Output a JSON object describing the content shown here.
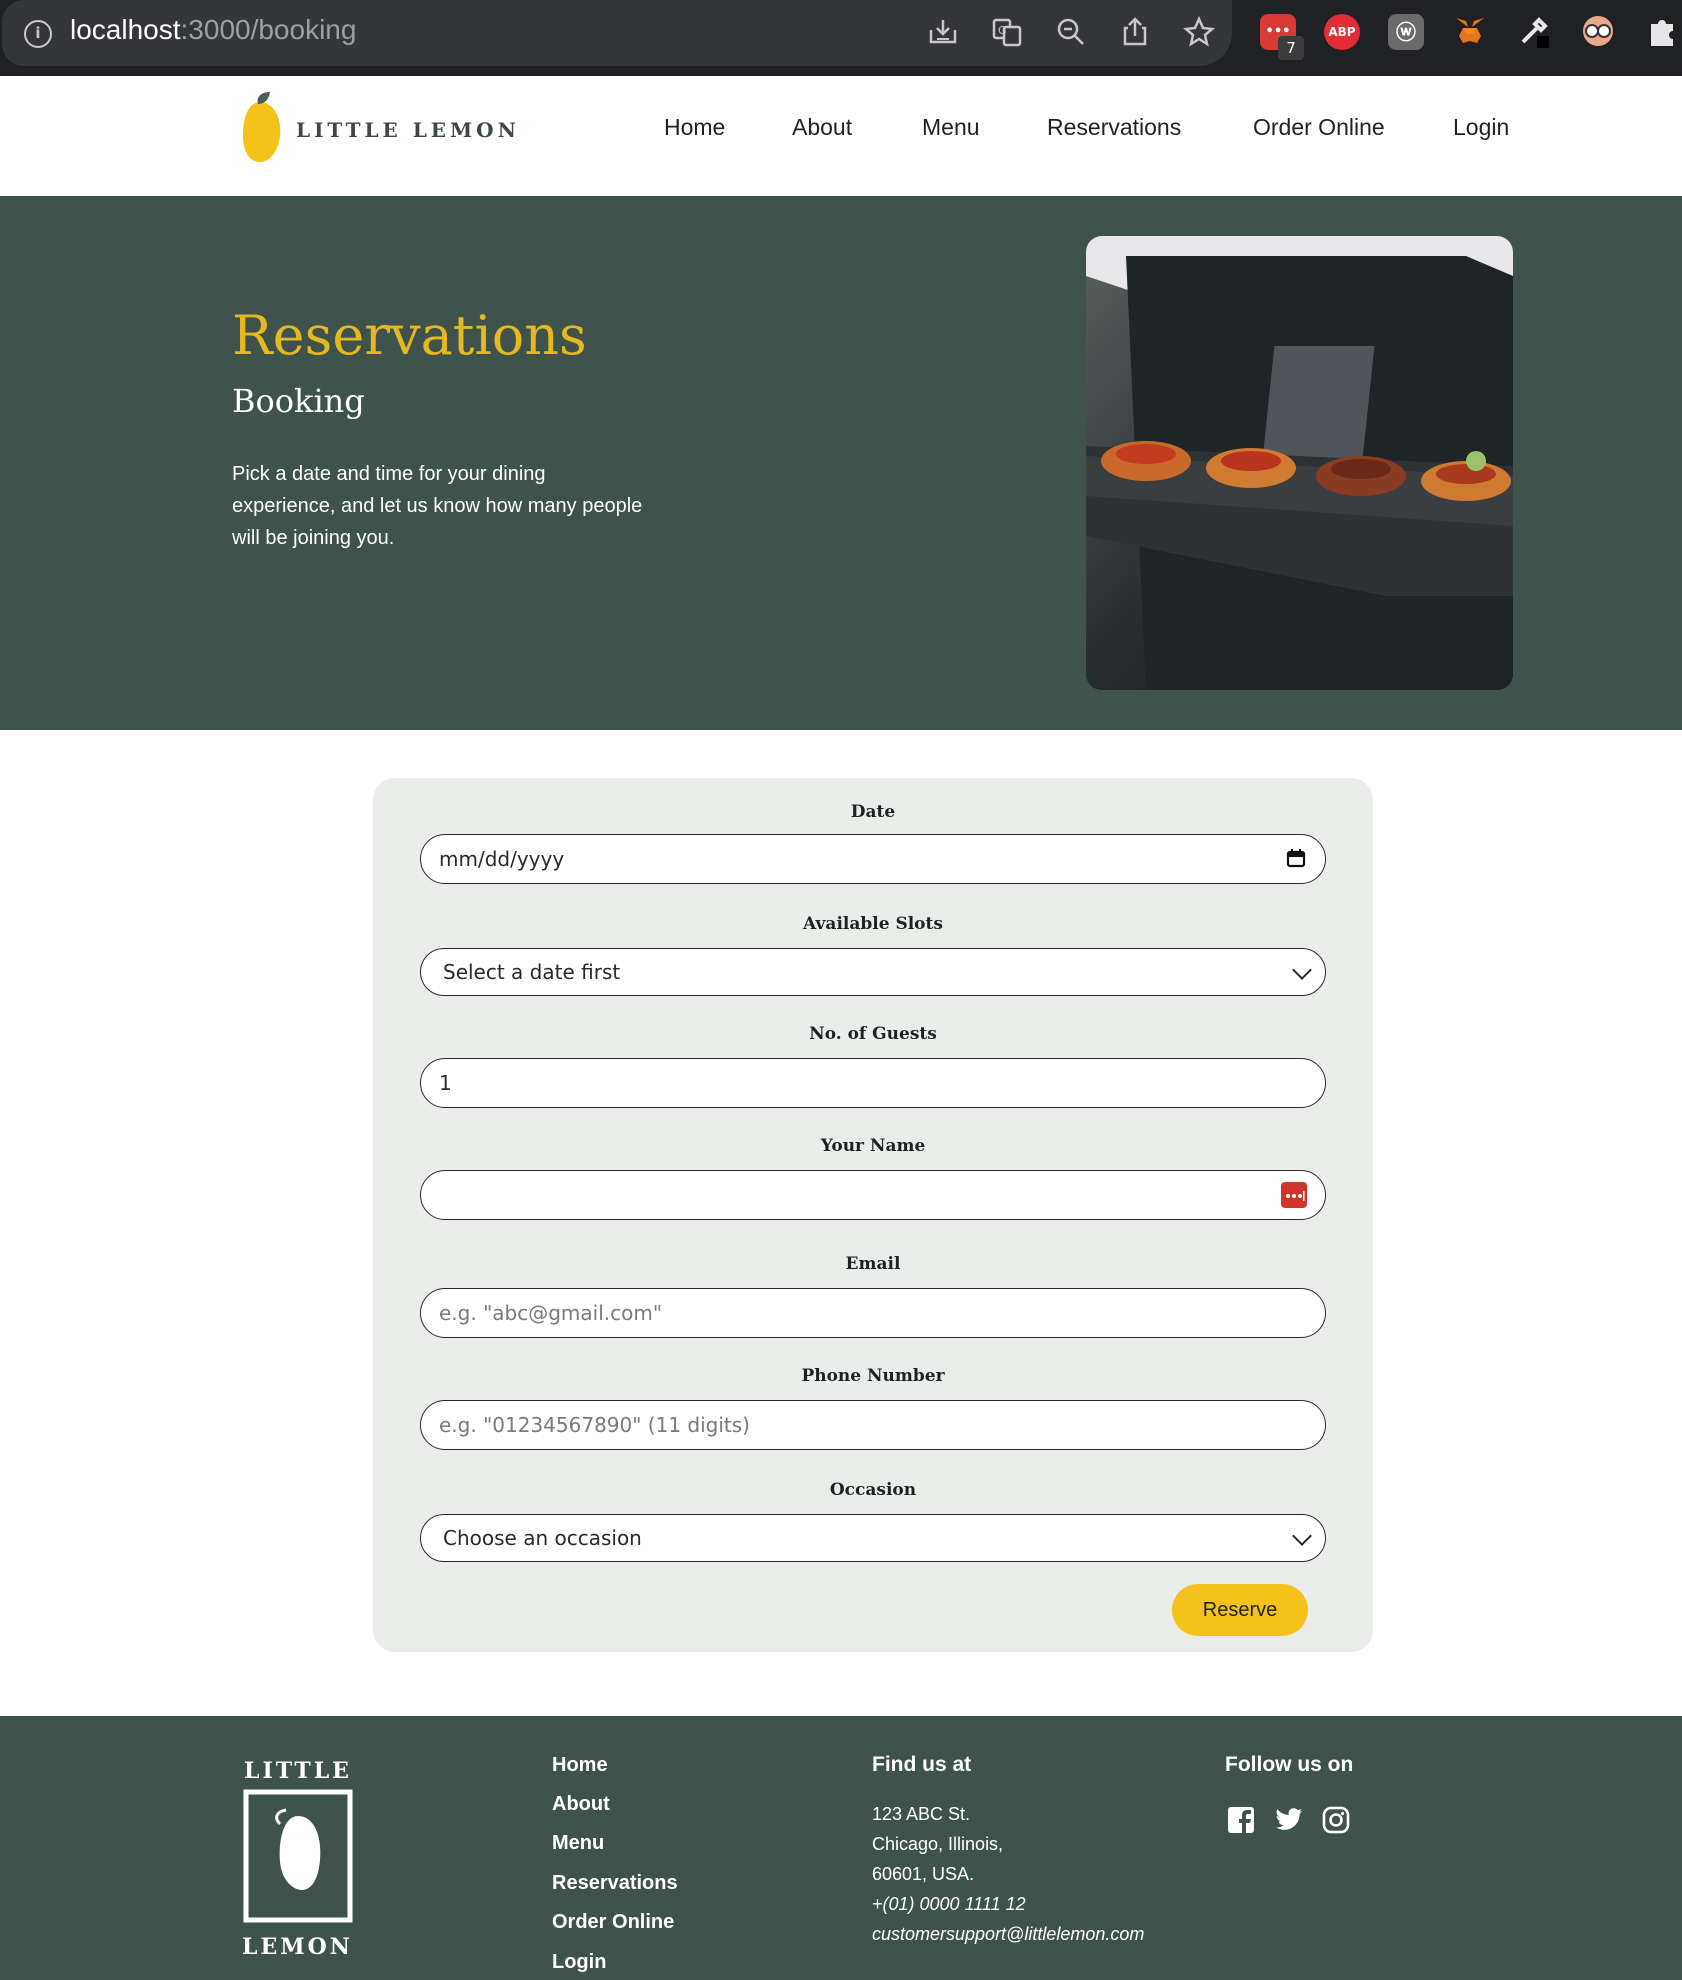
{
  "browser": {
    "url_host": "localhost",
    "url_path": ":3000/booking",
    "ext_badge": "7",
    "ext_abp": "ABP"
  },
  "header": {
    "logo_text": "LITTLE LEMON",
    "nav": [
      "Home",
      "About",
      "Menu",
      "Reservations",
      "Order Online",
      "Login"
    ]
  },
  "hero": {
    "title": "Reservations",
    "subtitle": "Booking",
    "description": "Pick a date and time for your dining experience, and let us know how many people will be joining you."
  },
  "form": {
    "date_label": "Date",
    "date_placeholder": "mm/dd/yyyy",
    "slots_label": "Available Slots",
    "slots_value": "Select a date first",
    "guests_label": "No. of Guests",
    "guests_value": "1",
    "name_label": "Your Name",
    "name_value": "",
    "email_label": "Email",
    "email_placeholder": "e.g. \"abc@gmail.com\"",
    "phone_label": "Phone Number",
    "phone_placeholder": "e.g. \"01234567890\" (11 digits)",
    "occasion_label": "Occasion",
    "occasion_value": "Choose an occasion",
    "submit_label": "Reserve"
  },
  "footer": {
    "logo_top": "LITTLE",
    "logo_bottom": "LEMON",
    "links": [
      "Home",
      "About",
      "Menu",
      "Reservations",
      "Order Online",
      "Login"
    ],
    "find_heading": "Find us at",
    "address_1": "123 ABC St.",
    "address_2": "Chicago, Illinois,",
    "address_3": "60601, USA.",
    "phone": "+(01) 0000 1111 12",
    "email": "customersupport@littlelemon.com",
    "follow_heading": "Follow us on",
    "social_icons": [
      "facebook-icon",
      "twitter-icon",
      "instagram-icon"
    ]
  },
  "colors": {
    "brand_green": "#3f524c",
    "brand_yellow": "#f4c21a",
    "title_yellow": "#e3b820",
    "form_bg": "#ebedeb"
  }
}
